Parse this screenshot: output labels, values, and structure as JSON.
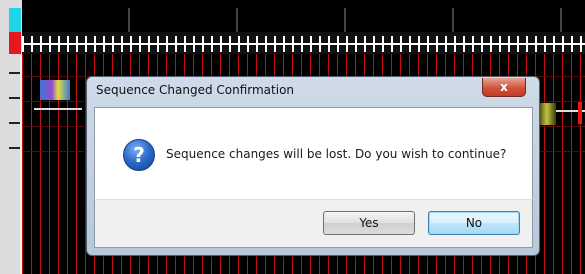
{
  "dialog": {
    "title": "Sequence Changed Confirmation",
    "close_glyph": "x",
    "icon": "question-icon",
    "icon_glyph": "?",
    "message": "Sequence changes will be lost.  Do you wish to continue?",
    "buttons": {
      "yes_label": "Yes",
      "no_label": "No"
    },
    "default_button": "No"
  },
  "colors": {
    "timeline_marker_cyan": "#1fd6e8",
    "timeline_marker_red": "#e8161e",
    "grid_line_red": "#c81010",
    "dialog_frame": "#b7c8da",
    "close_button_red": "#c33b25"
  }
}
